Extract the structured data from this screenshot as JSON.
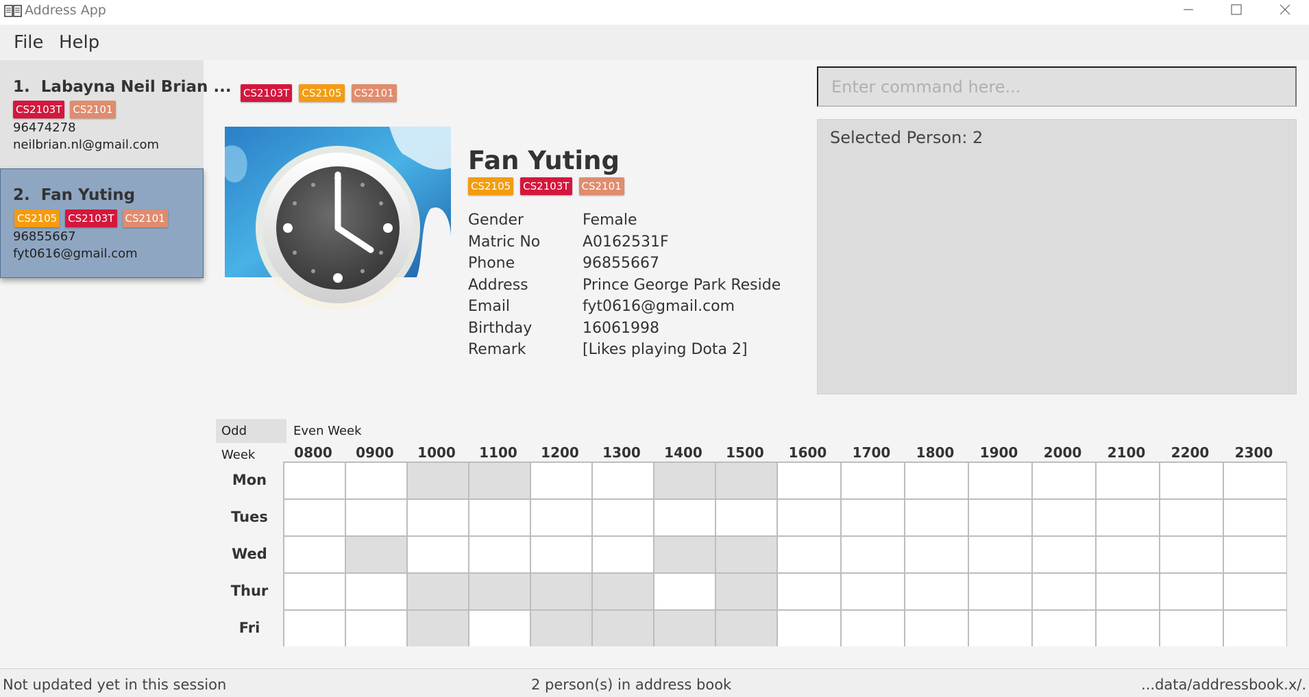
{
  "window": {
    "title": "Address App",
    "app_icon": "book-icon",
    "controls": [
      "minimize-icon",
      "maximize-icon",
      "close-icon"
    ]
  },
  "menu": {
    "items": [
      "File",
      "Help"
    ]
  },
  "person_list": [
    {
      "index": "1.",
      "name": "Labayna Neil Brian ...",
      "tags": [
        "CS2103T",
        "CS2101"
      ],
      "phone": "96474278",
      "email": "neilbrian.nl@gmail.com",
      "selected": false
    },
    {
      "index": "2.",
      "name": "Fan Yuting",
      "tags": [
        "CS2105",
        "CS2103T",
        "CS2101"
      ],
      "phone": "96855667",
      "email": "fyt0616@gmail.com",
      "selected": true
    }
  ],
  "tag_colors": {
    "CS2103T": "#d4173d",
    "CS2105": "#f39c12",
    "CS2101": "#e08c6e"
  },
  "detail": {
    "header_tags": [
      "CS2103T",
      "CS2105",
      "CS2101"
    ],
    "photo_icon": "clock-icon",
    "name": "Fan Yuting",
    "tags": [
      "CS2105",
      "CS2103T",
      "CS2101"
    ],
    "fields": [
      {
        "label": "Gender",
        "value": "Female"
      },
      {
        "label": "Matric No",
        "value": "A0162531F"
      },
      {
        "label": "Phone",
        "value": "96855667"
      },
      {
        "label": "Address",
        "value": "Prince George Park Reside..."
      },
      {
        "label": "Email",
        "value": "fyt0616@gmail.com"
      },
      {
        "label": "Birthday",
        "value": "16061998"
      },
      {
        "label": "Remark",
        "value": "[Likes playing Dota 2]"
      }
    ]
  },
  "command": {
    "placeholder": "Enter command here...",
    "value": ""
  },
  "result": {
    "text": "Selected Person: 2"
  },
  "timetable": {
    "tabs": [
      "Odd Week",
      "Even Week"
    ],
    "active_tab": "Odd Week",
    "times": [
      "0800",
      "0900",
      "1000",
      "1100",
      "1200",
      "1300",
      "1400",
      "1500",
      "1600",
      "1700",
      "1800",
      "1900",
      "2000",
      "2100",
      "2200",
      "2300"
    ],
    "days": [
      "Mon",
      "Tues",
      "Wed",
      "Thur",
      "Fri"
    ],
    "busy": {
      "Mon": [
        "1000",
        "1100",
        "1400",
        "1500"
      ],
      "Tues": [],
      "Wed": [
        "0900",
        "1400",
        "1500"
      ],
      "Thur": [
        "1000",
        "1100",
        "1200",
        "1300",
        "1500"
      ],
      "Fri": [
        "1000",
        "1200",
        "1300",
        "1400",
        "1500"
      ]
    },
    "busy_color": "#dedede",
    "free_color": "#ffffff"
  },
  "status": {
    "sync": "Not updated yet in this session",
    "count": "2 person(s) in address book",
    "path": "...data/addressbook.x/."
  }
}
